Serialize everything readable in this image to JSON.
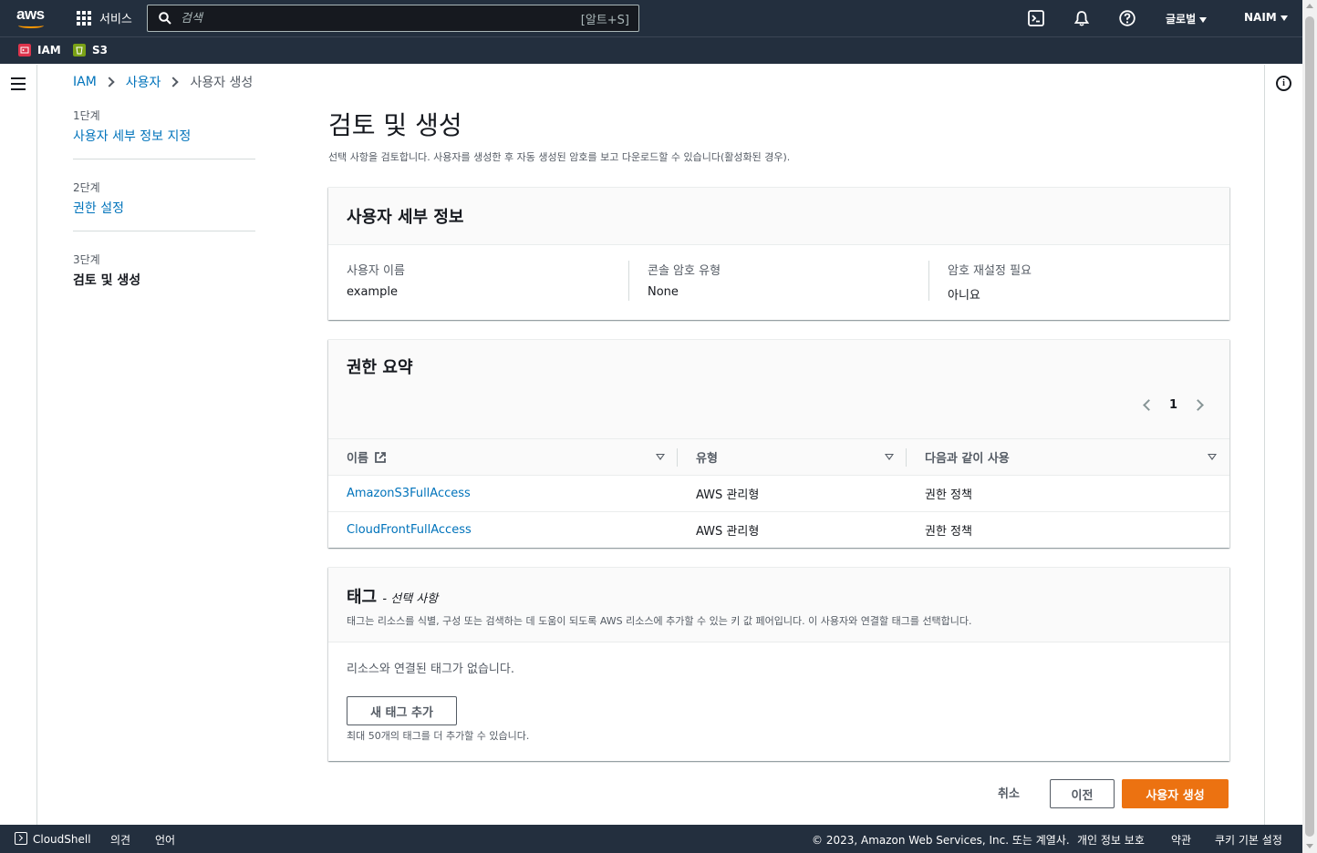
{
  "topnav": {
    "logo": "aws",
    "services_label": "서비스",
    "search_placeholder": "검색",
    "search_shortcut": "[알트+S]",
    "region_label": "글로벌",
    "account_label": "NAIM",
    "icons": [
      "cloudshell-icon",
      "bell-icon",
      "help-icon"
    ]
  },
  "favorites": [
    {
      "label": "IAM",
      "icon": "iam-icon",
      "color": "#dd344c"
    },
    {
      "label": "S3",
      "icon": "s3-icon",
      "color": "#7aa116"
    }
  ],
  "breadcrumb": {
    "items": [
      "IAM",
      "사용자"
    ],
    "current": "사용자 생성"
  },
  "steps": [
    {
      "num": "1단계",
      "label": "사용자 세부 정보 지정"
    },
    {
      "num": "2단계",
      "label": "권한 설정"
    },
    {
      "num": "3단계",
      "label": "검토 및 생성"
    }
  ],
  "page": {
    "title": "검토 및 생성",
    "description": "선택 사항을 검토합니다. 사용자를 생성한 후 자동 생성된 암호를 보고 다운로드할 수 있습니다(활성화된 경우)."
  },
  "user_details": {
    "title": "사용자 세부 정보",
    "fields": [
      {
        "key": "사용자 이름",
        "value": "example"
      },
      {
        "key": "콘솔 암호 유형",
        "value": "None"
      },
      {
        "key": "암호 재설정 필요",
        "value": "아니요"
      }
    ]
  },
  "permissions": {
    "title": "권한 요약",
    "page": "1",
    "columns": [
      "이름",
      "유형",
      "다음과 같이 사용"
    ],
    "rows": [
      {
        "name": "AmazonS3FullAccess",
        "type": "AWS 관리형",
        "used_as": "권한 정책"
      },
      {
        "name": "CloudFrontFullAccess",
        "type": "AWS 관리형",
        "used_as": "권한 정책"
      }
    ]
  },
  "tags": {
    "title": "태그",
    "optional": "- 선택 사항",
    "description": "태그는 리소스를 식별, 구성 또는 검색하는 데 도움이 되도록 AWS 리소스에 추가할 수 있는 키 값 페어입니다. 이 사용자와 연결할 태그를 선택합니다.",
    "empty": "리소스와 연결된 태그가 없습니다.",
    "add_button": "새 태그 추가",
    "limit": "최대 50개의 태그를 더 추가할 수 있습니다."
  },
  "actions": {
    "cancel": "취소",
    "previous": "이전",
    "create": "사용자 생성"
  },
  "footer": {
    "cloudshell": "CloudShell",
    "feedback": "의견",
    "language": "언어",
    "copyright": "© 2023, Amazon Web Services, Inc. 또는 계열사.",
    "privacy": "개인 정보 보호",
    "terms": "약관",
    "cookies": "쿠키 기본 설정"
  },
  "colors": {
    "nav_bg": "#232f3e",
    "link": "#0073bb",
    "primary": "#ec7211"
  }
}
